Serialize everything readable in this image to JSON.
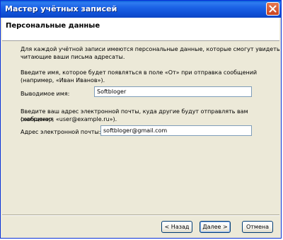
{
  "window": {
    "title": "Мастер учётных записей"
  },
  "header": {
    "title": "Персональные данные"
  },
  "intro": {
    "line1": "Для каждой учётной записи имеются персональные данные, которые смогут увидеть",
    "line2": "читающие ваши письма адресаты."
  },
  "name_section": {
    "line1": "Введите имя, которое будет появляться в поле «От» при отправка сообщений",
    "line2": "(например, «Иван Иванов»).",
    "label": "Выводимое имя:",
    "value": "Softbloger"
  },
  "email_section": {
    "line1": "Введите ваш адрес электронной почты, куда другие будут отправлять вам сообщения",
    "line2": "(например, «user@example.ru»).",
    "label": "Адрес электронной почты:",
    "value": "softbloger@gmail.com"
  },
  "buttons": {
    "back": "< Назад",
    "next": "Далее >",
    "cancel": "Отмена"
  },
  "icons": {
    "close": "close-icon"
  },
  "colors": {
    "titlebar": "#0f50d6",
    "dialog_bg": "#ece9d8",
    "close_button": "#c94421",
    "input_border": "#7f9db9"
  }
}
